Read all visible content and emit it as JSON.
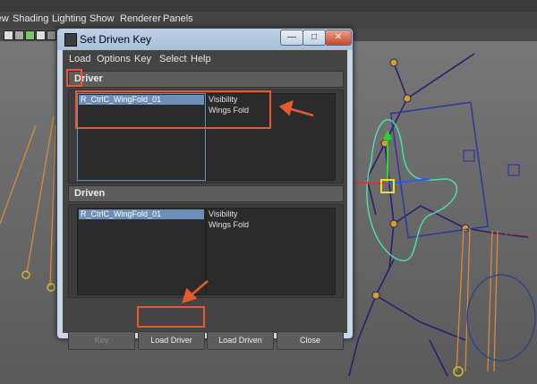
{
  "viewport": {
    "menus": [
      "View",
      "Shading",
      "Lighting",
      "Show",
      "Renderer",
      "Panels"
    ]
  },
  "dialog": {
    "title": "Set Driven Key",
    "window_buttons": {
      "minimize": "—",
      "maximize": "□",
      "close": "✕"
    },
    "menus": [
      "Load",
      "Options",
      "Key",
      "Select",
      "Help"
    ],
    "driver": {
      "header": "Driver",
      "objects": [
        "R_CtrlC_WingFold_01"
      ],
      "attributes": [
        "Visibility",
        "Wings Fold"
      ]
    },
    "driven": {
      "header": "Driven",
      "objects": [
        "R_CtrlC_WingFold_01"
      ],
      "attributes": [
        "Visibility",
        "Wings Fold"
      ]
    },
    "buttons": {
      "key": "Key",
      "load_driver": "Load Driver",
      "load_driven": "Load Driven",
      "close": "Close"
    }
  },
  "colors": {
    "annotation": "#e8592d",
    "selection": "#6d8fb7",
    "panel_bg": "#444444"
  }
}
